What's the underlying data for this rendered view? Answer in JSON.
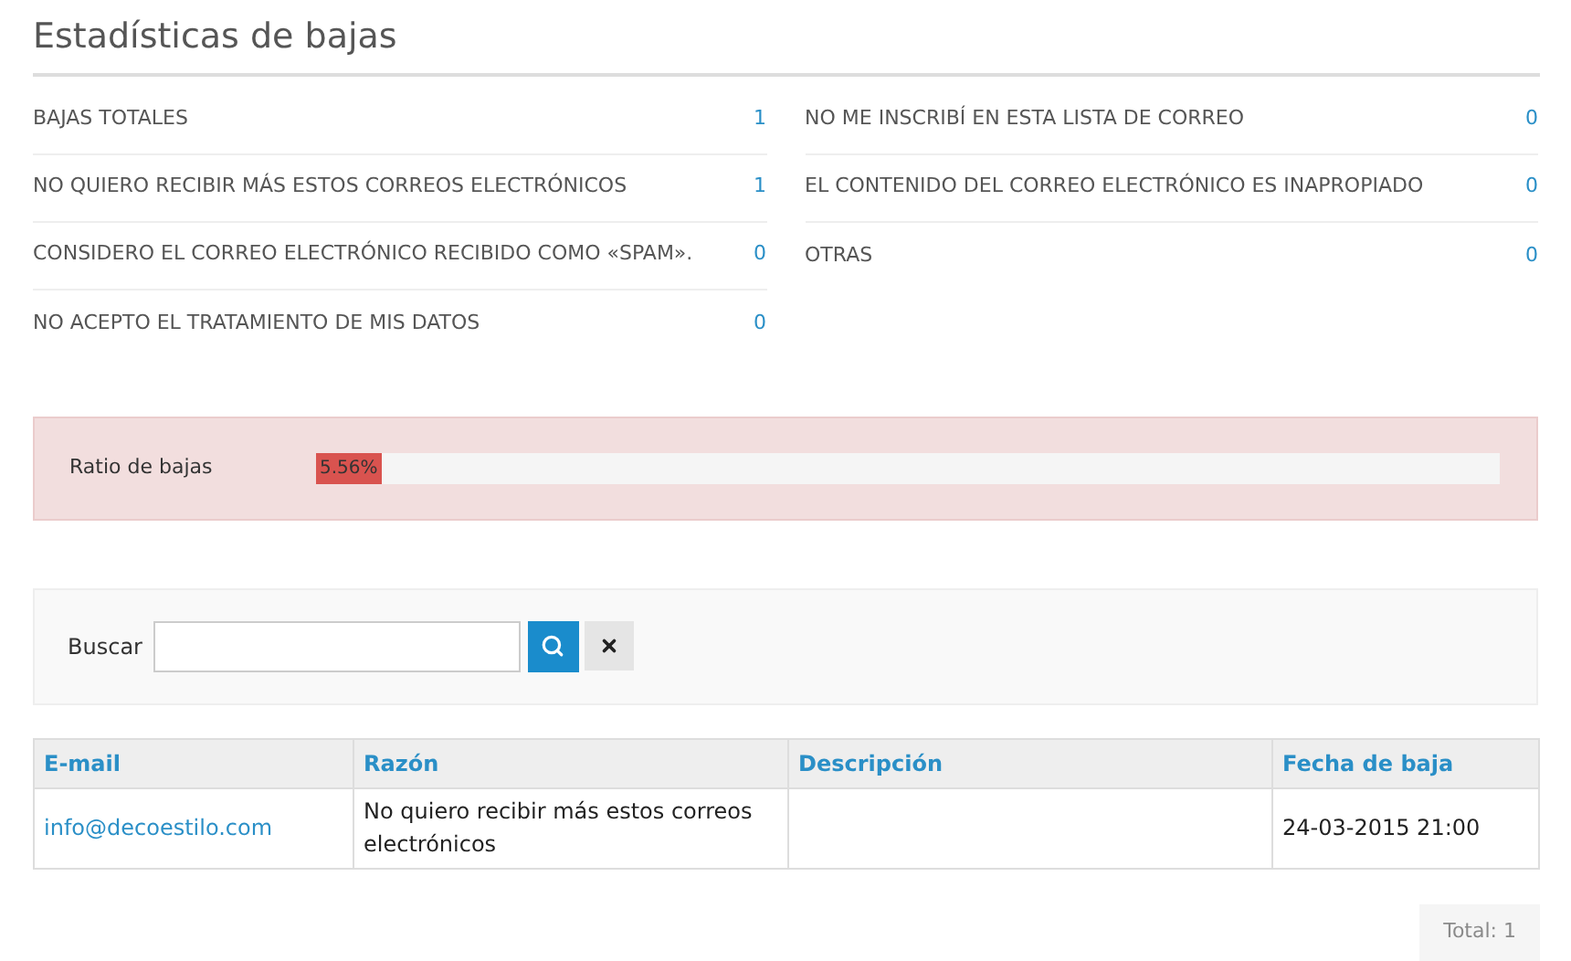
{
  "title": "Estadísticas de bajas",
  "stats_left": [
    {
      "label": "BAJAS TOTALES",
      "value": "1"
    },
    {
      "label": "NO QUIERO RECIBIR MÁS ESTOS CORREOS ELECTRÓNICOS",
      "value": "1"
    },
    {
      "label": "CONSIDERO EL CORREO ELECTRÓNICO RECIBIDO COMO «SPAM».",
      "value": "0"
    },
    {
      "label": "NO ACEPTO EL TRATAMIENTO DE MIS DATOS",
      "value": "0"
    }
  ],
  "stats_right": [
    {
      "label": "NO ME INSCRIBÍ EN ESTA LISTA DE CORREO",
      "value": "0"
    },
    {
      "label": "EL CONTENIDO DEL CORREO ELECTRÓNICO ES INAPROPIADO",
      "value": "0"
    },
    {
      "label": "OTRAS",
      "value": "0"
    }
  ],
  "ratio": {
    "label": "Ratio de bajas",
    "reading": "5.56%",
    "level": 0.0556
  },
  "search": {
    "label": "Buscar"
  },
  "table": {
    "columns": [
      "E-mail",
      "Razón",
      "Descripción",
      "Fecha de baja"
    ],
    "rows": [
      {
        "email": "info@decoestilo.com",
        "reason": "No quiero recibir más estos correos electrónicos",
        "description": "",
        "date": "24-03-2015 21:00"
      }
    ]
  },
  "total": "Total: 1"
}
